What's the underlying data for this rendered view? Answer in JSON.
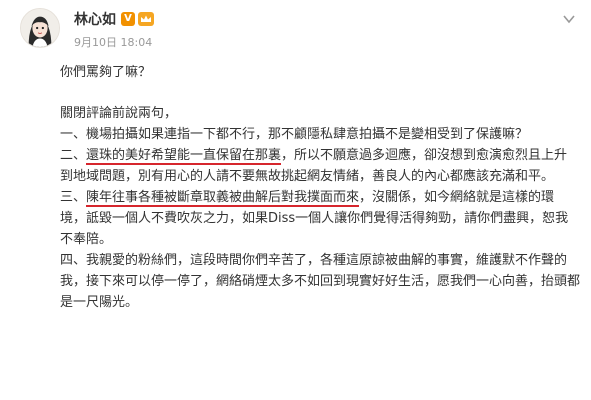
{
  "post": {
    "author": {
      "name": "林心如"
    },
    "timestamp": "9月10日 18:04",
    "paragraphs": {
      "p1": "你們罵夠了嘛？",
      "p2": "關閉評論前說兩句，",
      "p3": "一、機場拍攝如果連指一下都不行，那不顧隱私肆意拍攝不是變相受到了保護嘛？",
      "p4": {
        "prefix": "二、",
        "underlined": "還珠的美好希望能一直保留在那裏",
        "rest": "，所以不願意過多迴應，卻沒想到愈演愈烈且上升到地域問題，別有用心的人請不要無故挑起網友情緒，善良人的內心都應該充滿和平。"
      },
      "p5": {
        "prefix": "三、",
        "underlined": "陳年往事各種被斷章取義被曲解后對我撲面而來",
        "rest": "，沒關係，如今網絡就是這樣的環境，詆毀一個人不費吹灰之力，如果Diss一個人讓你們覺得活得夠勁，請你們盡興，恕我不奉陪。"
      },
      "p6": "四、我親愛的粉絲們，這段時間你們辛苦了，各種這原諒被曲解的事實，維護默不作聲的我，接下來可以停一停了，網絡硝煙太多不如回到現實好好生活，愿我們一心向善，抬頭都是一尺陽光。"
    },
    "icons": {
      "verified": "verified-v-badge-icon",
      "member": "crown-member-icon",
      "menu": "chevron-down-icon"
    },
    "colors": {
      "underline": "#d6262d",
      "verified": "#f29100",
      "timestamp": "#999999"
    }
  }
}
